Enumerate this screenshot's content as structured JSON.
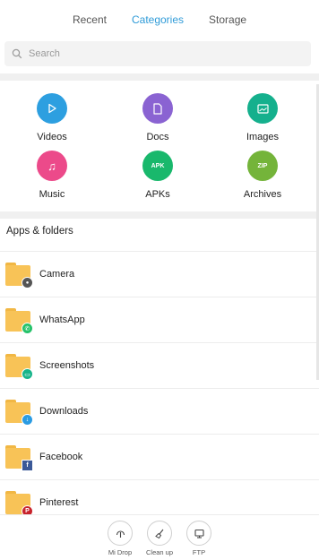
{
  "tabs": [
    {
      "label": "Recent",
      "active": false
    },
    {
      "label": "Categories",
      "active": true
    },
    {
      "label": "Storage",
      "active": false
    }
  ],
  "search": {
    "placeholder": "Search"
  },
  "categories": [
    {
      "label": "Videos",
      "icon": "play-icon",
      "color": "#2d9fe0"
    },
    {
      "label": "Docs",
      "icon": "document-icon",
      "color": "#8a63d2"
    },
    {
      "label": "Images",
      "icon": "image-icon",
      "color": "#15b08d"
    },
    {
      "label": "Music",
      "icon": "music-note-icon",
      "color": "#ec4a8a",
      "glyph": "♫"
    },
    {
      "label": "APKs",
      "icon": "apk-icon",
      "color": "#19b86c",
      "glyph": "APK"
    },
    {
      "label": "Archives",
      "icon": "zip-icon",
      "color": "#74b43a",
      "glyph": "ZIP"
    }
  ],
  "section": {
    "title": "Apps & folders"
  },
  "folders": [
    {
      "name": "Camera",
      "badge_icon": "camera-icon",
      "badge_color": "#555555",
      "badge_glyph": "●"
    },
    {
      "name": "WhatsApp",
      "badge_icon": "whatsapp-icon",
      "badge_color": "#25c26a",
      "badge_glyph": "✆"
    },
    {
      "name": "Screenshots",
      "badge_icon": "screenshot-icon",
      "badge_color": "#17b48a",
      "badge_glyph": "▭"
    },
    {
      "name": "Downloads",
      "badge_icon": "download-icon",
      "badge_color": "#2a9be2",
      "badge_glyph": "↓"
    },
    {
      "name": "Facebook",
      "badge_icon": "facebook-icon",
      "badge_color": "#3b5998",
      "badge_glyph": "f"
    },
    {
      "name": "Pinterest",
      "badge_icon": "pinterest-icon",
      "badge_color": "#c8232c",
      "badge_glyph": "P"
    }
  ],
  "bottom_bar": [
    {
      "label": "Mi Drop",
      "icon": "mi-drop-icon"
    },
    {
      "label": "Clean up",
      "icon": "broom-icon"
    },
    {
      "label": "FTP",
      "icon": "ftp-icon"
    }
  ]
}
